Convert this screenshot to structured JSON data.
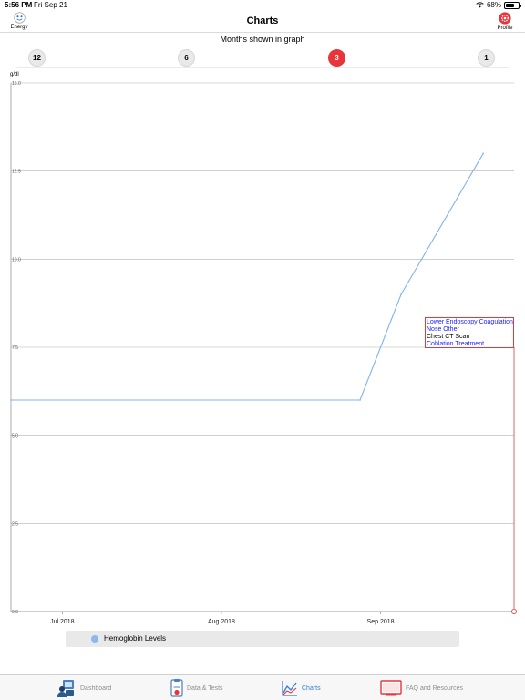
{
  "status_bar": {
    "time": "5:56 PM",
    "date": "Fri Sep 21",
    "battery": "68%",
    "battery_level": 0.68
  },
  "nav": {
    "title": "Charts",
    "left_label": "Energy",
    "right_label": "Profile"
  },
  "months": {
    "title": "Months shown in graph",
    "options": [
      "12",
      "6",
      "3",
      "1"
    ],
    "selected": "3"
  },
  "colors": {
    "accent": "#e8353b",
    "line": "#7fb3ec",
    "tab_active": "#2f7fd4",
    "annotation_border": "#e53935",
    "annotation_link": "#1a1aff"
  },
  "chart_data": {
    "type": "line",
    "ylabel": "g/dl",
    "ylim": [
      0.0,
      15.0
    ],
    "yticks": [
      "0.0",
      "2.5",
      "5.0",
      "7.5",
      "10.0",
      "12.5",
      "15.0"
    ],
    "xticks": [
      "Jul 2018",
      "Aug 2018",
      "Sep 2018"
    ],
    "x_range": [
      "2018-06-21",
      "2018-09-27"
    ],
    "series": [
      {
        "name": "Hemoglobin Levels",
        "points": [
          {
            "x": "2018-06-21",
            "y": 6.0
          },
          {
            "x": "2018-08-28",
            "y": 6.0
          },
          {
            "x": "2018-09-05",
            "y": 9.0
          },
          {
            "x": "2018-09-21",
            "y": 13.0
          }
        ]
      }
    ],
    "annotation": {
      "x": "2018-09-27",
      "lines": [
        {
          "text": "Lower Endoscopy Coagulation",
          "link": true
        },
        {
          "text": "Nose Other",
          "link": true
        },
        {
          "text": "Chest CT Scan",
          "link": false
        },
        {
          "text": "Coblation Treatment",
          "link": true
        }
      ]
    },
    "grid": true,
    "legend": "bottom"
  },
  "tabs": [
    {
      "label": "Dashboard",
      "icon": "dashboard-icon"
    },
    {
      "label": "Data & Tests",
      "icon": "data-tests-icon"
    },
    {
      "label": "Charts",
      "icon": "charts-icon"
    },
    {
      "label": "FAQ and Resources",
      "icon": "faq-resources-icon"
    }
  ],
  "active_tab": "Charts"
}
